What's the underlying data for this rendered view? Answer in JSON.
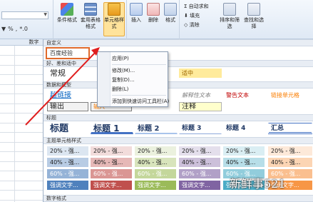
{
  "ribbon": {
    "currency": "▼",
    "percent": "%",
    "comma": ",",
    "dec_inc": "*.0",
    "cond_fmt": "条件格式",
    "table_fmt": "套用表格格式",
    "cell_styles": "单元格样式",
    "insert": "插入",
    "delete": "删除",
    "format": "格式",
    "sigma": "Σ",
    "autosum": "自动求和",
    "fill_icon": "⬇",
    "fill": "填充",
    "clear_icon": "◇",
    "clear": "清除",
    "sort": "排序和筛选",
    "find": "查找和选择"
  },
  "grid": {
    "col_header": "数字"
  },
  "gallery": {
    "sections": [
      "自定义",
      "好、差和适中",
      "数据和模型",
      "标题",
      "主题单元格样式",
      "数字格式"
    ],
    "custom_style": "百度经验",
    "normal": "常规",
    "neutral": "适中",
    "hyperlink": "超链接",
    "explanatory": "解释性文本",
    "warning": "警告文本",
    "linked": "链接单元格",
    "output": "输出",
    "input": "输入",
    "note": "注释",
    "title": "标题",
    "h1": "标题 1",
    "h2": "标题 2",
    "h3": "标题 3",
    "h4": "标题 4",
    "total": "汇总",
    "theme_rows": [
      {
        "label": "20% - 强...",
        "colors": [
          "#dce6f1",
          "#f2dcdb",
          "#ebf1de",
          "#e4dfec",
          "#daeef3",
          "#fde9d9"
        ],
        "text": "#222"
      },
      {
        "label": "40% - 强...",
        "colors": [
          "#b8cce4",
          "#e6b8b7",
          "#d8e4bc",
          "#ccc0da",
          "#b7dee8",
          "#fcd5b4"
        ],
        "text": "#222"
      },
      {
        "label": "60% - 强...",
        "colors": [
          "#95b3d7",
          "#da9694",
          "#c4d79b",
          "#b1a0c7",
          "#92cddc",
          "#fabf8f"
        ],
        "text": "#fff"
      },
      {
        "label": "强调文字...",
        "colors": [
          "#4f81bd",
          "#c0504d",
          "#9bbb59",
          "#8064a2",
          "#4bacc6",
          "#f79646"
        ],
        "text": "#fff"
      }
    ]
  },
  "menu": [
    "应用(P)",
    "修改(M)...",
    "复制(D)...",
    "删除(L)",
    "添加到快速访问工具栏(A)"
  ],
  "watermark": "新鲜事521"
}
